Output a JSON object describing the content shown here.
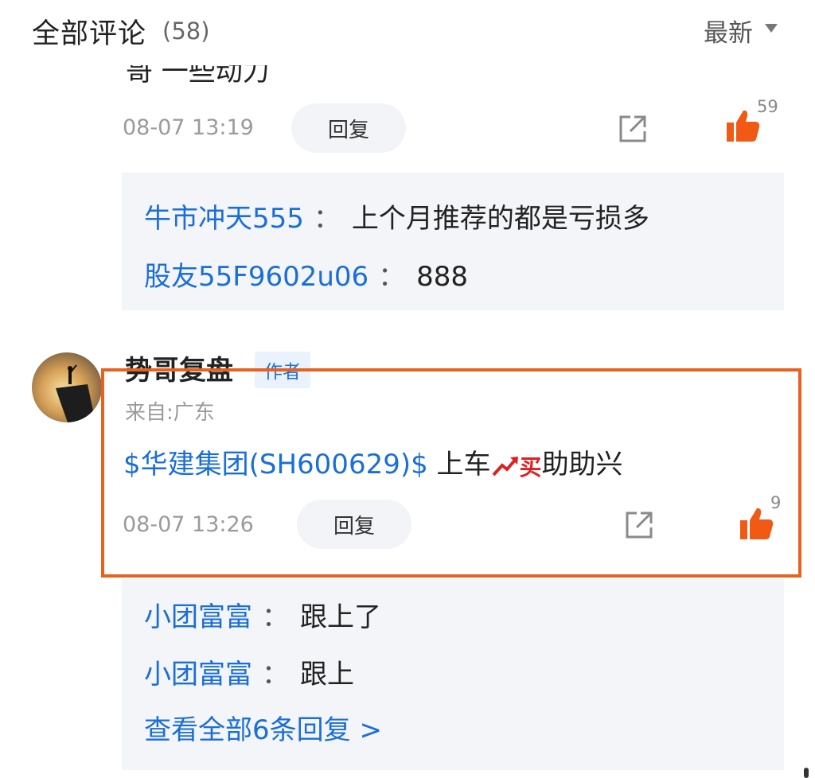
{
  "header": {
    "title": "全部评论",
    "count": "(58)",
    "sort_label": "最新"
  },
  "previous_comment": {
    "cut_text": "哥 一些动力",
    "time": "08-07 13:19",
    "reply_label": "回复",
    "like_count": "59",
    "replies": [
      {
        "user": "牛市冲天555",
        "colon": "：",
        "text": "上个月推荐的都是亏损多"
      },
      {
        "user": "股友55F9602u06",
        "colon": "：",
        "text": "888"
      }
    ]
  },
  "comment": {
    "author": "势哥复盘",
    "author_tag": "作者",
    "location": "来自:广东",
    "stock_link": "$华建集团(SH600629)$",
    "text_before": " 上车",
    "emoji_buy": "买",
    "text_after": "助助兴",
    "time": "08-07 13:26",
    "reply_label": "回复",
    "like_count": "9",
    "replies": [
      {
        "user": "小团富富",
        "colon": "：",
        "text": "跟上了"
      },
      {
        "user": "小团富富",
        "colon": "：",
        "text": "跟上"
      }
    ],
    "view_all": "查看全部6条回复 >"
  },
  "colors": {
    "link_blue": "#1a6ed8",
    "like_orange": "#f05a14",
    "highlight": "#e8621f"
  },
  "icons": [
    "chevron-down-icon",
    "share-icon",
    "thumbs-up-icon",
    "trend-up-emoji",
    "buy-emoji"
  ]
}
